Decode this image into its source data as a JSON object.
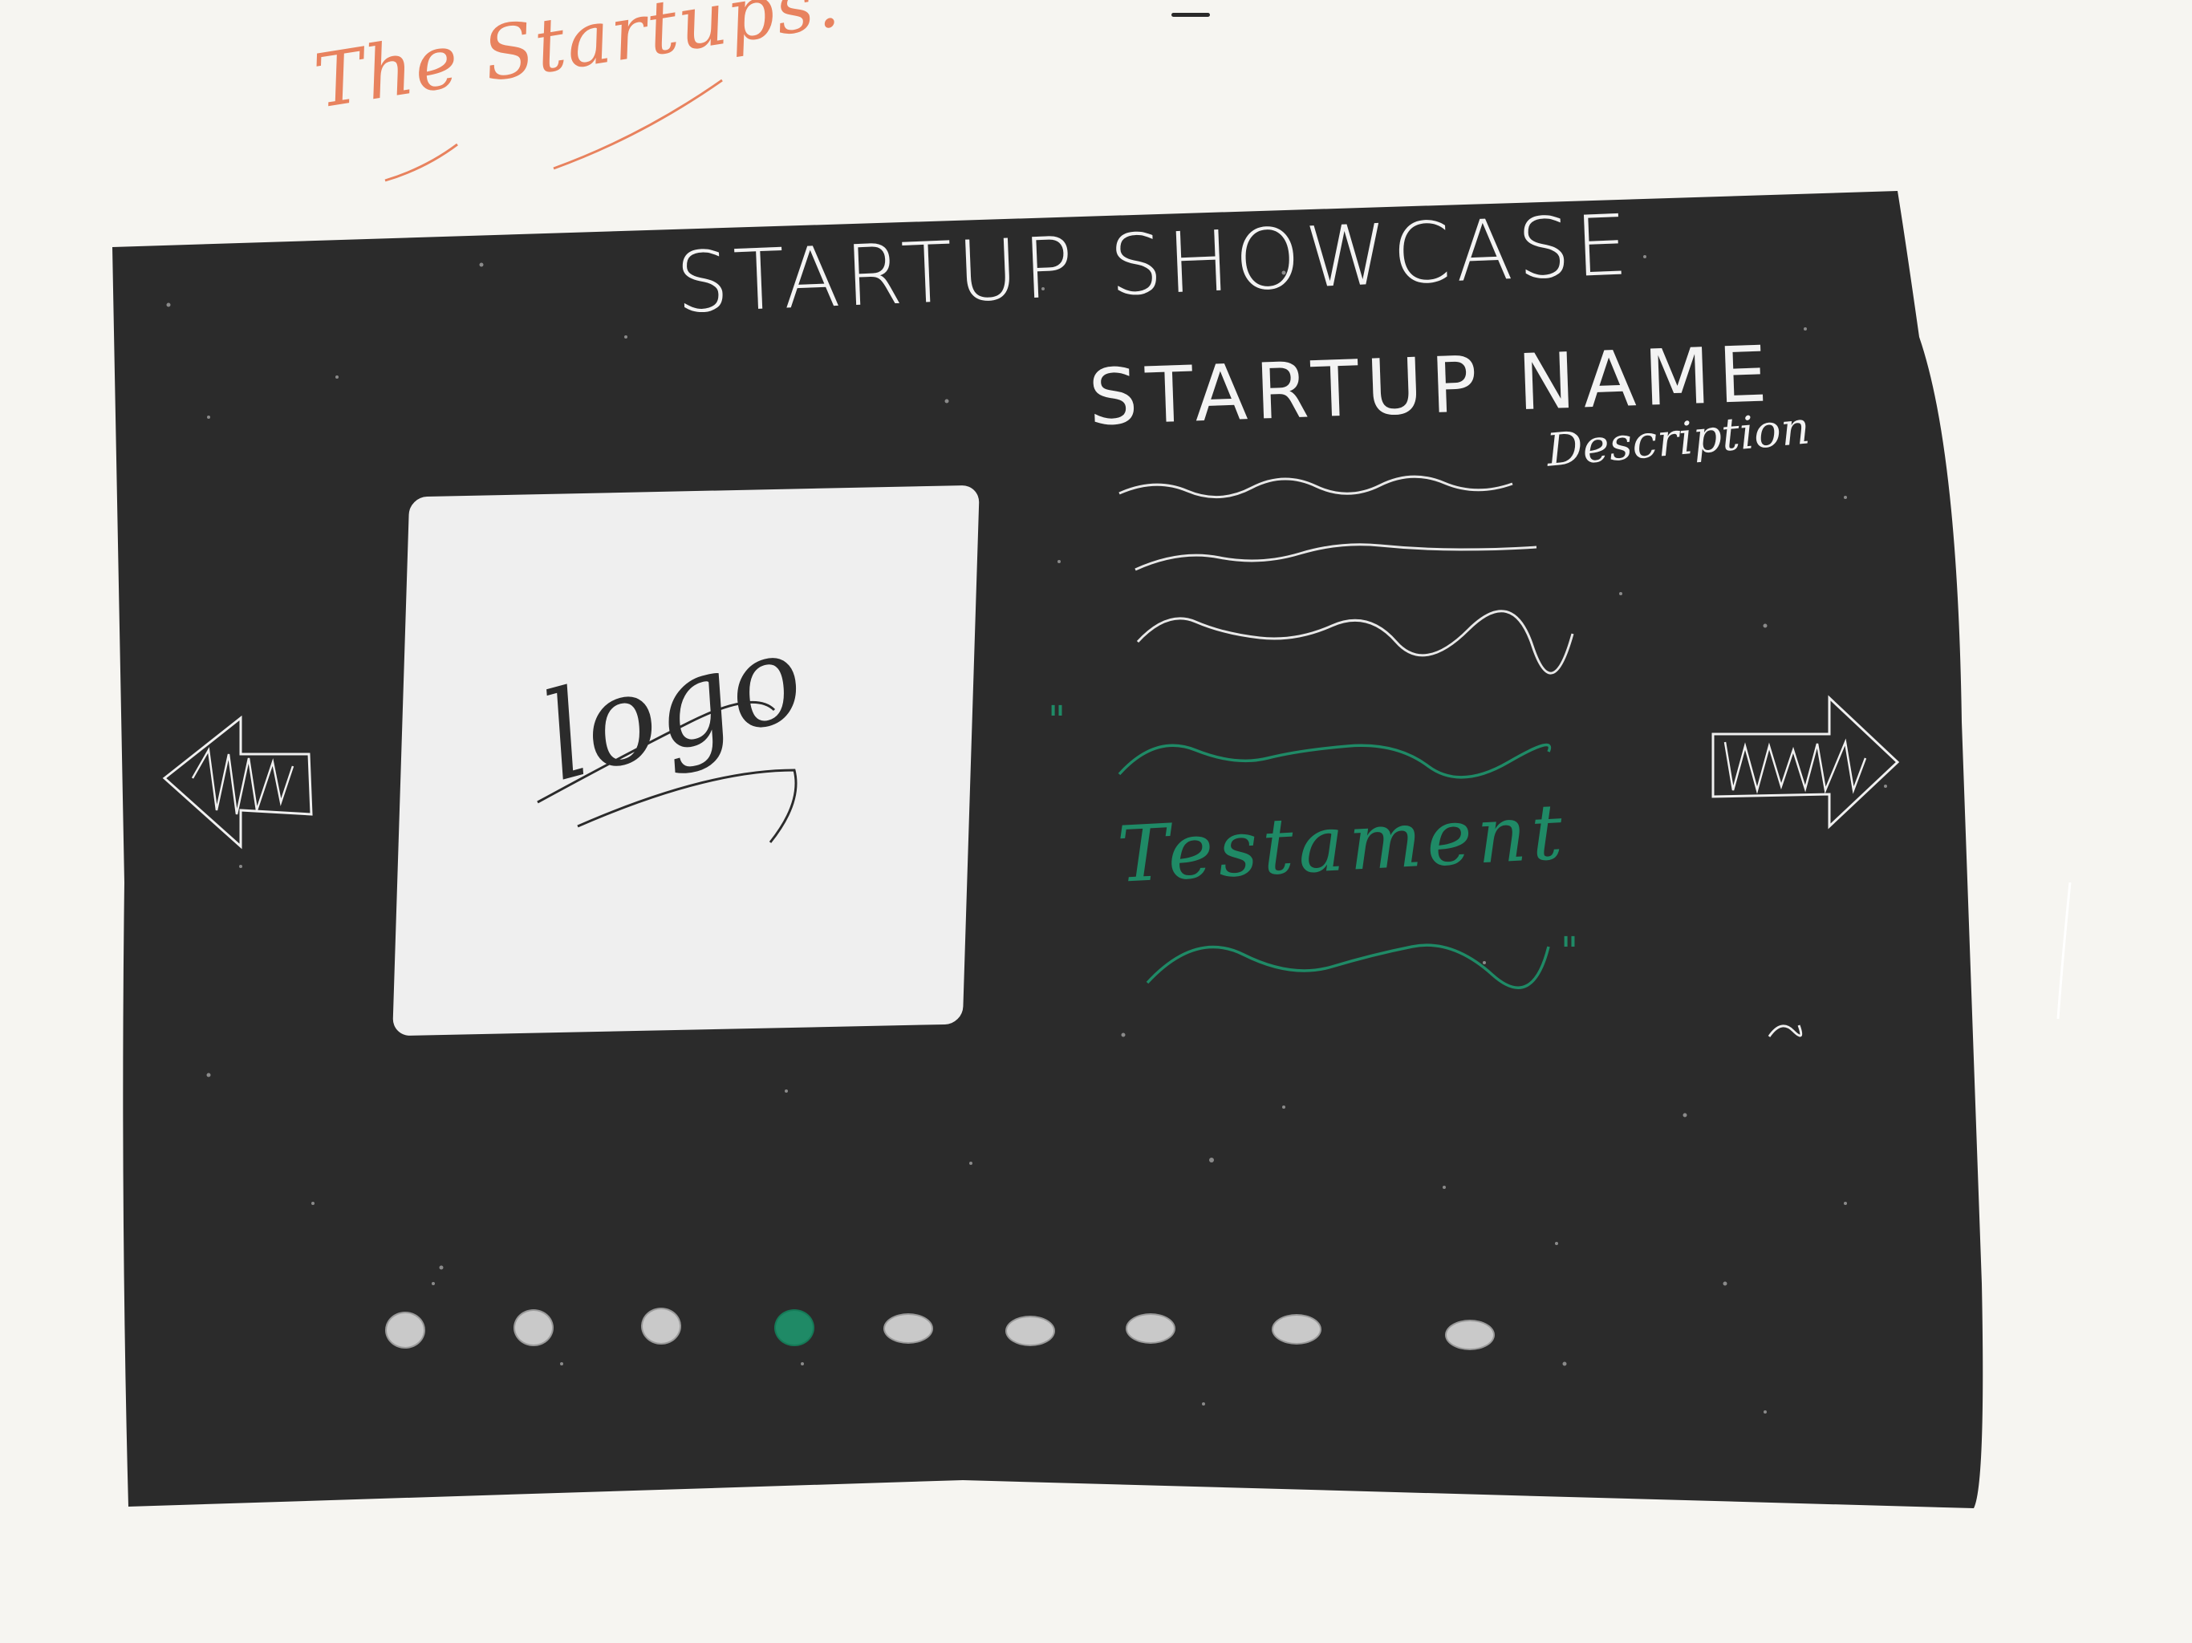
{
  "sketch_title": "The Startups.",
  "hero": {
    "title": "STARTUP SHOWCASE"
  },
  "startup": {
    "name": "STARTUP NAME",
    "description_label": "Description",
    "logo_label": "logo",
    "testimonial_label": "Testament",
    "open_quote": "\"",
    "close_quote": "\""
  },
  "navigation": {
    "prev": "left-arrow-icon",
    "next": "right-arrow-icon"
  },
  "pagination": {
    "count": 9,
    "active_index": 3
  },
  "colors": {
    "board": "#2b2b2b",
    "paper": "#f6f5f1",
    "accent": "#1f8a66",
    "title_sketch": "#e8825e",
    "ink_light": "#f3f3f3",
    "dot_inactive": "#c9c9c9"
  }
}
